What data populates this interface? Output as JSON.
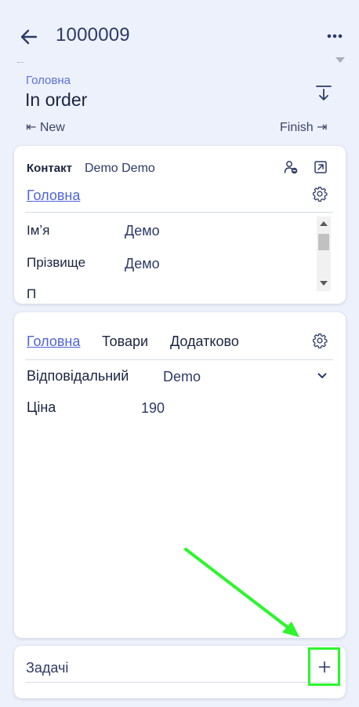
{
  "header": {
    "title": "1000009",
    "back_icon": "arrow-left-icon",
    "more_icon": "more-horizontal-icon"
  },
  "stage": {
    "label": "Головна",
    "value": "In order",
    "collapse_icon": "arrow-down-to-line-icon",
    "prev": "⇤ New",
    "next": "Finish ⇥"
  },
  "contact_card": {
    "label": "Контакт",
    "value": "Demo Demo",
    "tab": "Головна",
    "rows": [
      {
        "label": "Імʼя",
        "value": "Демо"
      },
      {
        "label": "Прізвище",
        "value": "Демо"
      },
      {
        "label": "П",
        "value": ""
      }
    ]
  },
  "deal_card": {
    "tabs": [
      "Головна",
      "Товари",
      "Додатково"
    ],
    "fields": [
      {
        "label": "Відповідальний",
        "value": "Demo"
      },
      {
        "label": "Ціна",
        "value": "190"
      }
    ]
  },
  "tasks_card": {
    "label": "Задачі",
    "add_label": "+"
  },
  "colors": {
    "background": "#edf1fb",
    "accent": "#4f63d9",
    "highlight": "#2cf52c"
  }
}
